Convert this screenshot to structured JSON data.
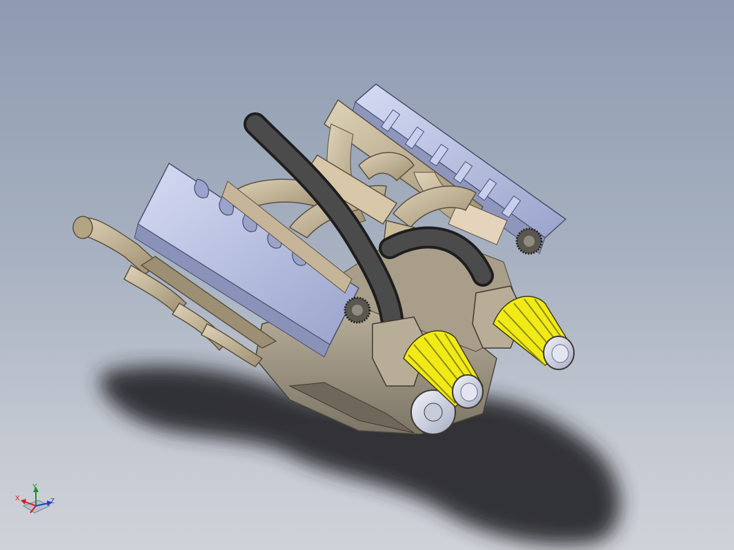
{
  "viewport": {
    "model": "v8-engine-assembly",
    "background_top": "#8e9bb0",
    "background_bottom": "#cfd2d8"
  },
  "colors": {
    "manifold": "#c8b89a",
    "cover": "#b6bfe6",
    "hose": "#3d3d3d",
    "filter_pleats": "#f1ea16",
    "block": "#a29a88"
  },
  "triad": {
    "x_label": "X",
    "y_label": "Y",
    "z_label": "Z",
    "x_color": "#d21c1c",
    "y_color": "#1f8f2a",
    "z_color": "#2040c8"
  }
}
